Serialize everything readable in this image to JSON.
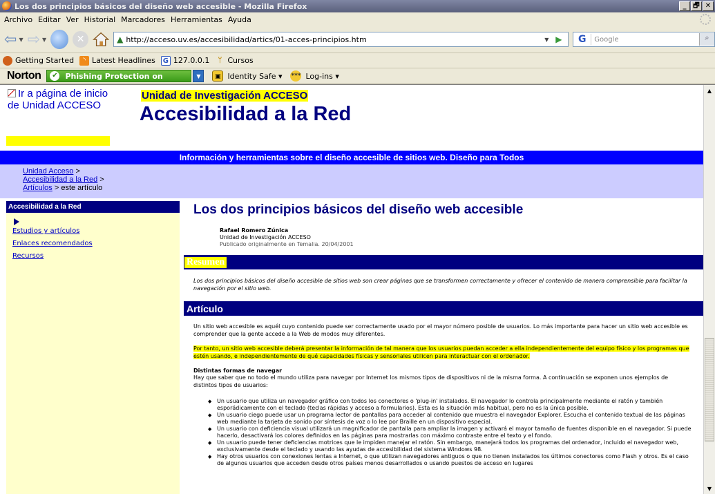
{
  "window": {
    "title": "Los dos principios básicos del diseño web accesible - Mozilla Firefox",
    "controls": [
      "_",
      "🗗",
      "✕"
    ]
  },
  "menu": [
    "Archivo",
    "Editar",
    "Ver",
    "Historial",
    "Marcadores",
    "Herramientas",
    "Ayuda"
  ],
  "navbar": {
    "url": "http://acceso.uv.es/accesibilidad/artics/01-acces-principios.htm",
    "search_placeholder": "Google",
    "search_engine_glyph": "G"
  },
  "bookmarks": [
    {
      "label": "Getting Started",
      "icon": "firefox-icon",
      "color": "#d0601a"
    },
    {
      "label": "Latest Headlines",
      "icon": "rss-icon",
      "color": "#f08a1a"
    },
    {
      "label": "127.0.0.1",
      "icon": "google-icon",
      "color": "#2a55c0"
    },
    {
      "label": "Cursos",
      "icon": "folder-icon",
      "color": "#c89a2a"
    }
  ],
  "norton": {
    "brand": "Norton",
    "phishing": "Phishing Protection on",
    "identity": "Identity Safe ▾",
    "logins": "Log-ins ▾"
  },
  "page": {
    "logo_link": "Ir a página de inicio de Unidad ACCESO",
    "org": "Unidad de Investigación ACCESO",
    "site_title": "Accesibilidad a la Red",
    "tagline": "Información y herramientas sobre el diseño accesible de sitios web. Diseño para Todos",
    "crumbs": {
      "c1": "Unidad Acceso",
      "c2": "Accesibilidad a la Red",
      "c3": "Artículos",
      "sep": ">",
      "current": "> este artículo"
    },
    "sidebar": {
      "heading": "Accesibilidad a la Red",
      "links": [
        "Estudios y artículos",
        "Enlaces recomendados",
        "Recursos"
      ]
    },
    "article": {
      "title": "Los dos principios básicos del diseño web accesible",
      "author": "Rafael Romero Zúnica",
      "affiliation": "Unidad de Investigación ACCESO",
      "published": "Publicado originalmente en Temalia. 20/04/2001",
      "resumen_heading": "Resumen",
      "abstract": "Los dos principios básicos del diseño accesible de sitios web son crear páginas que se transformen correctamente y ofrecer el contenido de manera comprensible para facilitar la navegación por el sitio web.",
      "articulo_heading": "Artículo",
      "p1": "Un sitio web accesible es aquél cuyo contenido puede ser correctamente usado por el mayor número posible de usuarios. Lo más importante para hacer un sitio web accesible es comprender que la gente accede a la Web de modos muy diferentes.",
      "p2": "Por tanto, un sitio web accesible deberá presentar la información de tal manera que los usuarios puedan acceder a ella independientemente del equipo físico y los programas que estén usando, e independientemente de qué capacidades físicas y sensoriales utilicen para interactuar con el ordenador.",
      "subhead": "Distintas formas de navegar",
      "p3": "Hay que saber que no todo el mundo utiliza para navegar por Internet los mismos tipos de dispositivos ni de la misma forma. A continuación se exponen unos ejemplos de distintos tipos de usuarios:",
      "bullets": [
        "Un usuario que utiliza un navegador gráfico con todos los conectores o 'plug-in' instalados. El navegador lo controla principalmente mediante el ratón y también esporádicamente con el teclado (teclas rápidas y acceso a formularios). Esta es la situación más habitual, pero no es la única posible.",
        "Un usuario ciego puede usar un programa lector de pantallas para acceder al contenido que muestra el navegador Explorer. Escucha el contenido textual de las páginas web mediante la tarjeta de sonido por síntesis de voz o lo lee por Braille en un dispositivo especial.",
        "Un usuario con deficiencia visual utilizará un magnificador de pantalla para ampliar la imagen y activará el mayor tamaño de fuentes disponible en el navegador. Si puede hacerlo, desactivará los colores definidos en las páginas para mostrarlas con máximo contraste entre el texto y el fondo.",
        "Un usuario puede tener deficiencias motrices que le impiden manejar el ratón. Sin embargo, manejará todos los programas del ordenador, incluido el navegador web, exclusivamente desde el teclado y usando las ayudas de accesibilidad del sistema Windows 98.",
        "Hay otros usuarios con conexiones lentas a Internet, o que utilizan navegadores antiguos o que no tienen instalados los últimos conectores como Flash y otros. Es el caso de algunos usuarios que acceden desde otros países menos desarrollados o usando puestos de acceso en lugares"
      ]
    }
  },
  "colors": {
    "navy": "#000080",
    "blue_bar": "#0000ff",
    "highlight": "#ffff00",
    "crumb_bg": "#ccccff",
    "sidebar_bg": "#ffffcc"
  }
}
